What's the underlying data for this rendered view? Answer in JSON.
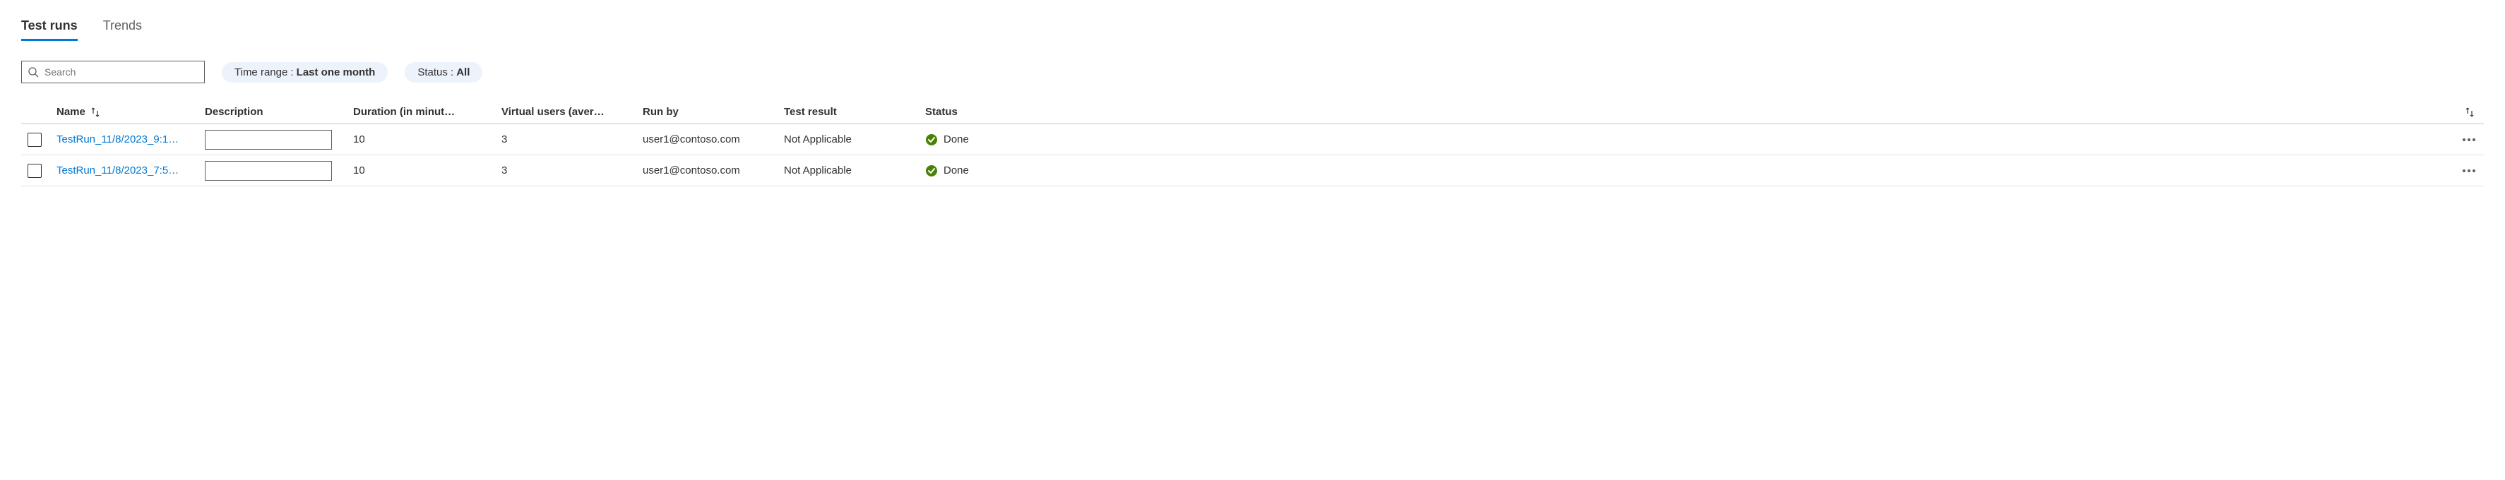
{
  "tabs": {
    "test_runs": "Test runs",
    "trends": "Trends"
  },
  "search": {
    "placeholder": "Search"
  },
  "filters": {
    "time_range_label": "Time range : ",
    "time_range_value": "Last one month",
    "status_label": "Status : ",
    "status_value": "All"
  },
  "columns": {
    "name": "Name",
    "description": "Description",
    "duration": "Duration (in minut…",
    "virtual_users": "Virtual users (aver…",
    "run_by": "Run by",
    "test_result": "Test result",
    "status": "Status"
  },
  "rows": [
    {
      "name": "TestRun_11/8/2023_9:1…",
      "description": "",
      "duration": "10",
      "virtual_users": "3",
      "run_by": "user1@contoso.com",
      "test_result": "Not Applicable",
      "status": "Done"
    },
    {
      "name": "TestRun_11/8/2023_7:5…",
      "description": "",
      "duration": "10",
      "virtual_users": "3",
      "run_by": "user1@contoso.com",
      "test_result": "Not Applicable",
      "status": "Done"
    }
  ]
}
